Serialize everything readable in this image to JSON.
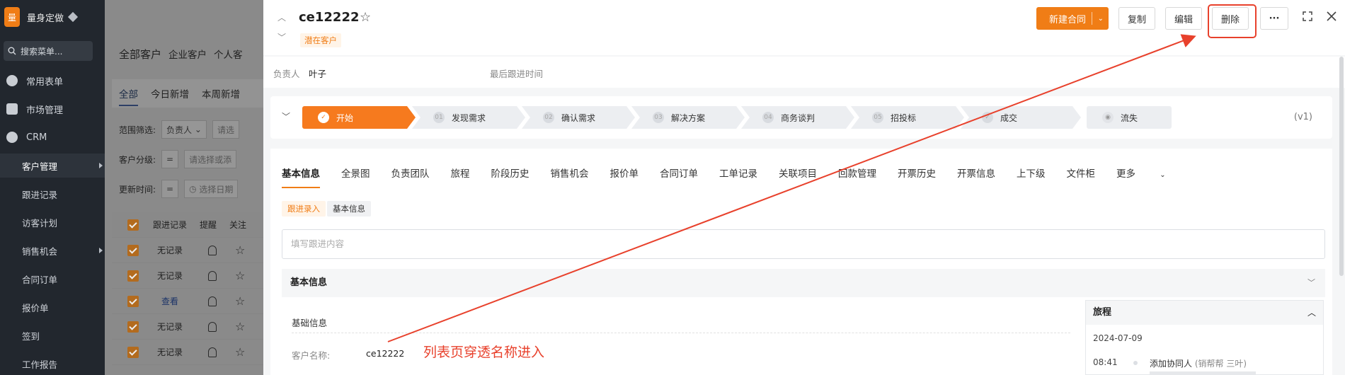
{
  "sidebar": {
    "logo_char": "量",
    "brand": "量身定做",
    "search_placeholder": "搜索菜单...",
    "items": [
      {
        "label": "常用表单",
        "icon": "star-circle-icon"
      },
      {
        "label": "市场管理",
        "icon": "clipboard-icon"
      },
      {
        "label": "CRM",
        "icon": "pie-chart-icon"
      }
    ],
    "sub_items": [
      {
        "label": "客户管理",
        "active": true
      },
      {
        "label": "跟进记录"
      },
      {
        "label": "访客计划"
      },
      {
        "label": "销售机会"
      },
      {
        "label": "合同订单"
      },
      {
        "label": "报价单"
      },
      {
        "label": "签到"
      },
      {
        "label": "工作报告"
      }
    ]
  },
  "background_page": {
    "tabs": [
      "全部客户",
      "企业客户",
      "个人客"
    ],
    "subtabs": [
      "全部",
      "今日新增",
      "本周新增"
    ],
    "filters": [
      {
        "label": "范围筛选:",
        "value": "负责人",
        "placeholder": "请选"
      },
      {
        "label": "客户分级:",
        "op": "=",
        "placeholder": "请选择或添"
      },
      {
        "label": "更新时间:",
        "op": "=",
        "placeholder": "选择日期"
      }
    ],
    "columns": [
      "跟进记录",
      "提醒",
      "关注"
    ],
    "rows": [
      "无记录",
      "无记录",
      "查看",
      "无记录",
      "无记录"
    ]
  },
  "record": {
    "title": "ce12222",
    "tag": "潜在客户",
    "owner_label": "负责人",
    "owner": "叶子",
    "last_follow_label": "最后跟进时间",
    "toolbar": {
      "new_contract": "新建合同",
      "copy": "复制",
      "edit": "编辑",
      "delete": "删除",
      "more": "···"
    },
    "stages": [
      {
        "num": "✓",
        "label": "开始"
      },
      {
        "num": "01",
        "label": "发现需求"
      },
      {
        "num": "02",
        "label": "确认需求"
      },
      {
        "num": "03",
        "label": "解决方案"
      },
      {
        "num": "04",
        "label": "商务谈判"
      },
      {
        "num": "05",
        "label": "招投标"
      },
      {
        "num": "✓",
        "label": "成交"
      },
      {
        "num": "◉",
        "label": "流失"
      }
    ],
    "version": "(v1)",
    "tabs": [
      "基本信息",
      "全景图",
      "负责团队",
      "旅程",
      "阶段历史",
      "销售机会",
      "报价单",
      "合同订单",
      "工单记录",
      "关联项目",
      "回款管理",
      "开票历史",
      "开票信息",
      "上下级",
      "文件柜",
      "更多"
    ],
    "pills": [
      "跟进录入",
      "基本信息"
    ],
    "follow_placeholder": "填写跟进内容",
    "section_title": "基本信息",
    "subsection": "基础信息",
    "field_label": "客户名称:",
    "field_value": "ce12222",
    "journey": {
      "title": "旅程",
      "date": "2024-07-09",
      "time": "08:41",
      "event": "添加协同人",
      "event_detail": "(销帮帮 三叶)"
    }
  },
  "annotation": {
    "text": "列表页穿透名称进入",
    "color": "#e8412c"
  },
  "colors": {
    "accent": "#f07d16",
    "sidebar_bg": "#22272e"
  }
}
